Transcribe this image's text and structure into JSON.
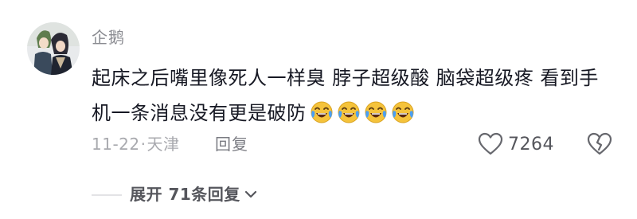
{
  "comment": {
    "username": "企鹅",
    "text": "起床之后嘴里像死人一样臭 脖子超级酸 脑袋超级疼 看到手机一条消息没有更是破防",
    "emoji_icons": [
      "laugh-cry-icon",
      "laugh-cry-icon",
      "laugh-cry-icon",
      "laugh-cry-icon"
    ],
    "date": "11-22",
    "separator": "·",
    "location": "天津",
    "reply_label": "回复",
    "like_count": "7264",
    "expand_replies_label": "展开 71条回复"
  },
  "colors": {
    "text_primary": "#161823",
    "text_secondary": "#a8a9ae",
    "username": "#8a8b91",
    "emoji_face": "#f5c33b",
    "emoji_tears": "#4a9ff5"
  }
}
